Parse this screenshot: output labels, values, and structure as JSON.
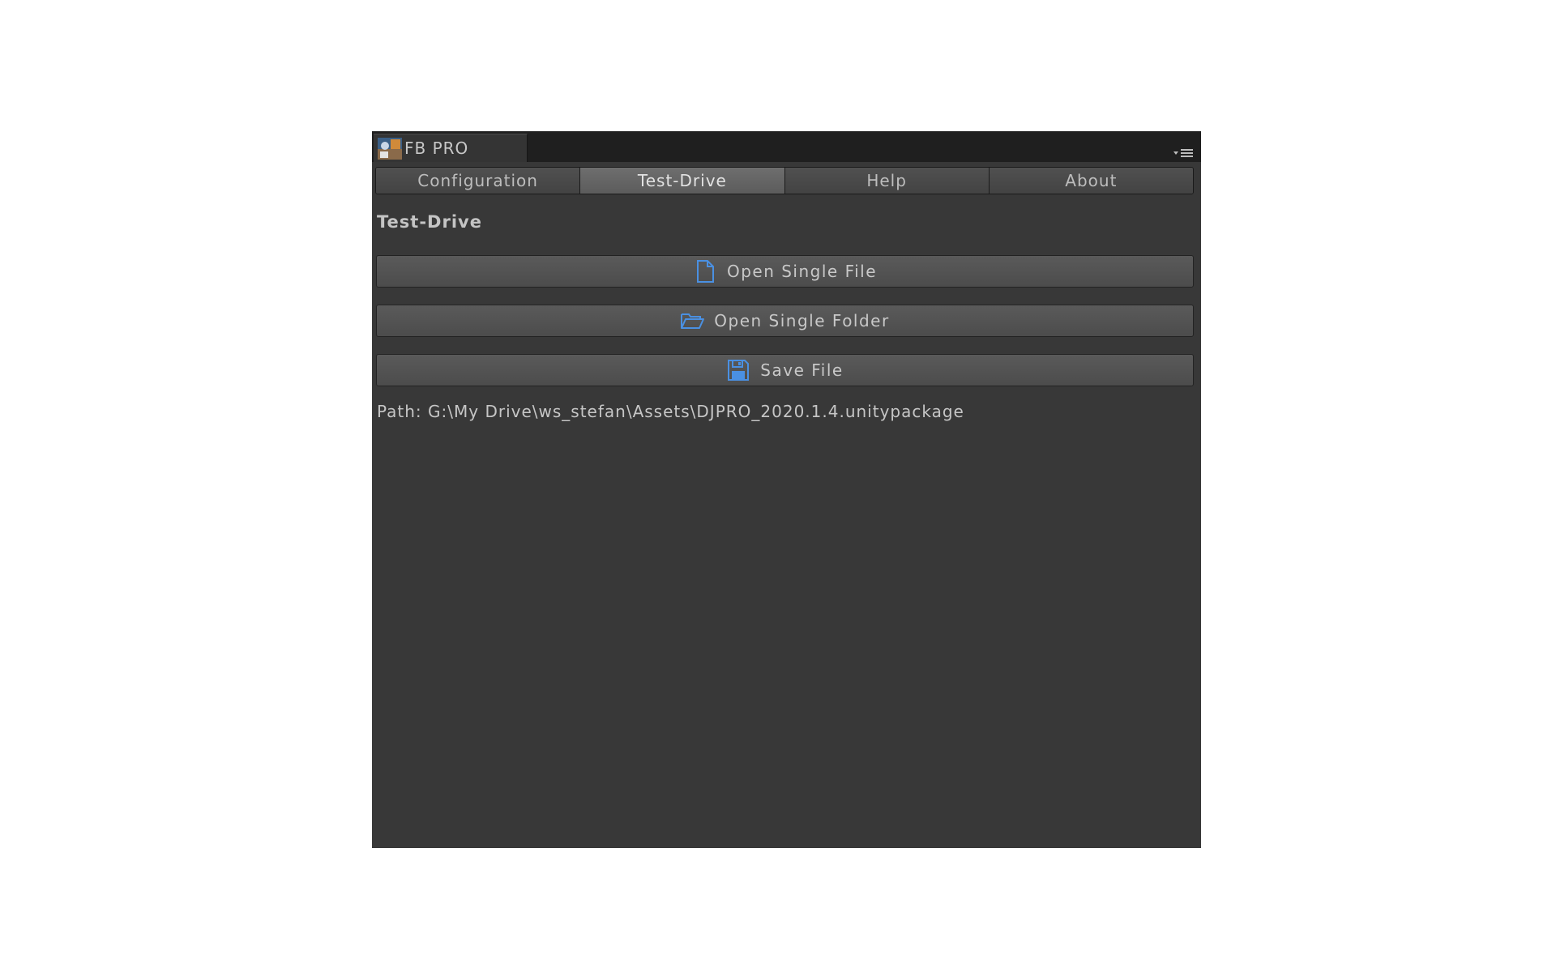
{
  "window": {
    "title": "FB PRO",
    "app_icon": "fb-pro-logo-icon",
    "menu_icon": "window-menu-icon"
  },
  "tabs": [
    {
      "label": "Configuration",
      "active": false
    },
    {
      "label": "Test-Drive",
      "active": true
    },
    {
      "label": "Help",
      "active": false
    },
    {
      "label": "About",
      "active": false
    }
  ],
  "content": {
    "section_title": "Test-Drive",
    "buttons": {
      "open_single_file": {
        "label": "Open Single File",
        "icon": "file-icon"
      },
      "open_single_folder": {
        "label": "Open Single Folder",
        "icon": "folder-open-icon"
      },
      "save_file": {
        "label": "Save File",
        "icon": "floppy-disk-icon"
      }
    },
    "path_text": "Path: G:\\My Drive\\ws_stefan\\Assets\\DJPRO_2020.1.4.unitypackage"
  },
  "colors": {
    "window_background": "#383838",
    "titlebar_background": "#1f1f1f",
    "icon_accent": "#4a90e2",
    "text": "#c8c8c8"
  }
}
